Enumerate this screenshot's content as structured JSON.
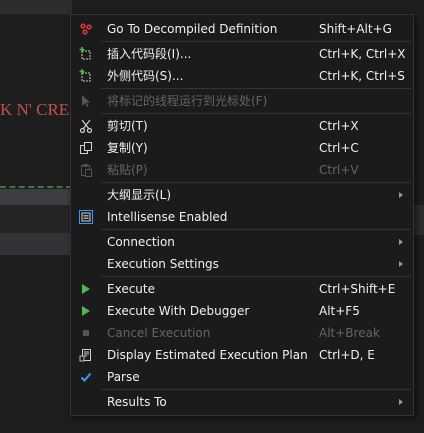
{
  "background": {
    "code_text": "K N' CREAT"
  },
  "menu": {
    "items": [
      {
        "label": "Go To Decompiled Definition",
        "shortcut": "Shift+Alt+G",
        "icon": "decompile-icon"
      },
      {
        "label": "插入代码段(I)...",
        "shortcut": "Ctrl+K, Ctrl+X",
        "icon": "insert-snippet-icon"
      },
      {
        "label": "外侧代码(S)...",
        "shortcut": "Ctrl+K, Ctrl+S",
        "icon": "surround-with-icon"
      },
      {
        "label": "将标记的线程运行到光标处(F)",
        "shortcut": "",
        "icon": "run-to-cursor-icon",
        "disabled": true
      },
      {
        "label": "剪切(T)",
        "shortcut": "Ctrl+X",
        "icon": "scissors-icon"
      },
      {
        "label": "复制(Y)",
        "shortcut": "Ctrl+C",
        "icon": "copy-icon"
      },
      {
        "label": "粘贴(P)",
        "shortcut": "Ctrl+V",
        "icon": "paste-icon",
        "disabled": true
      },
      {
        "label": "大纲显示(L)",
        "shortcut": "",
        "icon": "",
        "submenu": true
      },
      {
        "label": "Intellisense Enabled",
        "shortcut": "",
        "icon": "intellisense-checkbox-icon",
        "checked": true
      },
      {
        "label": "Connection",
        "shortcut": "",
        "icon": "",
        "submenu": true
      },
      {
        "label": "Execution Settings",
        "shortcut": "",
        "icon": "",
        "submenu": true
      },
      {
        "label": "Execute",
        "shortcut": "Ctrl+Shift+E",
        "icon": "play-icon"
      },
      {
        "label": "Execute With Debugger",
        "shortcut": "Alt+F5",
        "icon": "play-icon"
      },
      {
        "label": "Cancel Execution",
        "shortcut": "Alt+Break",
        "icon": "stop-icon",
        "disabled": true
      },
      {
        "label": "Display Estimated Execution Plan",
        "shortcut": "Ctrl+D, E",
        "icon": "execution-plan-icon"
      },
      {
        "label": "Parse",
        "shortcut": "",
        "icon": "checkmark-icon"
      },
      {
        "label": "Results To",
        "shortcut": "",
        "icon": "",
        "submenu": true
      }
    ]
  },
  "colors": {
    "menu_bg": "#1b1b1c",
    "menu_border": "#333337",
    "text": "#f1f1f1",
    "disabled_text": "#656565",
    "play_green": "#4fb84f",
    "check_blue": "#3399ff",
    "decompile_red": "#e03838"
  }
}
